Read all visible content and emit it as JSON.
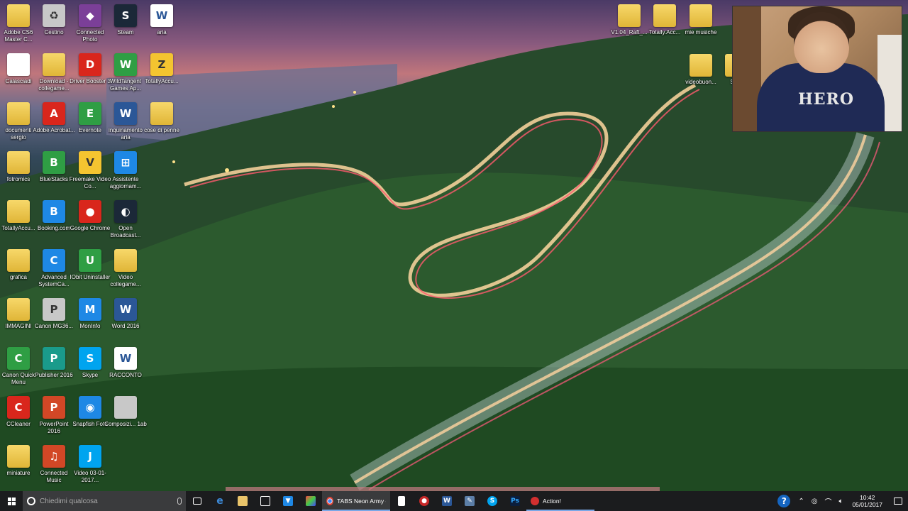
{
  "desktop": {
    "icons_col1": [
      {
        "label": "Adobe CS6 Master C...",
        "icon": "folder-icon",
        "glyph": "",
        "style": "g-folder"
      },
      {
        "label": "Calasciadi",
        "icon": "document-icon",
        "glyph": "",
        "style": "g-doc"
      },
      {
        "label": "documenti sergio",
        "icon": "folder-icon",
        "glyph": "",
        "style": "g-folder"
      },
      {
        "label": "fotromics",
        "icon": "folder-icon",
        "glyph": "",
        "style": "g-folder"
      },
      {
        "label": "TotallyAccu...",
        "icon": "folder-icon",
        "glyph": "",
        "style": "g-folder"
      },
      {
        "label": "grafica",
        "icon": "folder-icon",
        "glyph": "",
        "style": "g-folder"
      },
      {
        "label": "IMMAGINI",
        "icon": "folder-icon",
        "glyph": "",
        "style": "g-folder"
      },
      {
        "label": "Canon Quick Menu",
        "icon": "canon-icon",
        "glyph": "C",
        "style": "g-green"
      },
      {
        "label": "CCleaner",
        "icon": "ccleaner-icon",
        "glyph": "C",
        "style": "g-red"
      },
      {
        "label": "miniature",
        "icon": "folder-icon",
        "glyph": "",
        "style": "g-folder"
      }
    ],
    "icons_col2": [
      {
        "label": "Cestino",
        "icon": "recycle-bin-icon",
        "glyph": "♻",
        "style": "g-grey"
      },
      {
        "label": "Download - collegame...",
        "icon": "folder-icon",
        "glyph": "",
        "style": "g-folder"
      },
      {
        "label": "Adobe Acrobat...",
        "icon": "acrobat-icon",
        "glyph": "A",
        "style": "g-red"
      },
      {
        "label": "BlueStacks",
        "icon": "bluestacks-icon",
        "glyph": "B",
        "style": "g-green"
      },
      {
        "label": "Booking.com",
        "icon": "booking-icon",
        "glyph": "B",
        "style": "g-blue"
      },
      {
        "label": "Advanced SystemCa...",
        "icon": "advanced-systemcare-icon",
        "glyph": "C",
        "style": "g-blue"
      },
      {
        "label": "Canon MG36...",
        "icon": "printer-icon",
        "glyph": "P",
        "style": "g-grey"
      },
      {
        "label": "Publisher 2016",
        "icon": "publisher-icon",
        "glyph": "P",
        "style": "g-teal"
      },
      {
        "label": "PowerPoint 2016",
        "icon": "powerpoint-icon",
        "glyph": "P",
        "style": "g-orange"
      },
      {
        "label": "Connected Music",
        "icon": "connected-music-icon",
        "glyph": "♫",
        "style": "g-orange"
      }
    ],
    "icons_col3": [
      {
        "label": "Connected Photo",
        "icon": "connected-photo-icon",
        "glyph": "◆",
        "style": "g-purple"
      },
      {
        "label": "Driver Booster 3",
        "icon": "driver-booster-icon",
        "glyph": "D",
        "style": "g-red"
      },
      {
        "label": "Evernote",
        "icon": "evernote-icon",
        "glyph": "E",
        "style": "g-green"
      },
      {
        "label": "Freemake Video Co...",
        "icon": "freemake-icon",
        "glyph": "V",
        "style": "g-yellow"
      },
      {
        "label": "Google Chrome",
        "icon": "chrome-icon",
        "glyph": "●",
        "style": "g-red"
      },
      {
        "label": "IObit Uninstaller",
        "icon": "iobit-icon",
        "glyph": "U",
        "style": "g-green"
      },
      {
        "label": "MonInfo",
        "icon": "moninfo-icon",
        "glyph": "M",
        "style": "g-blue"
      },
      {
        "label": "Skype",
        "icon": "skype-icon",
        "glyph": "S",
        "style": "g-sky"
      },
      {
        "label": "Snapfish Foto",
        "icon": "snapfish-icon",
        "glyph": "◉",
        "style": "g-blue"
      },
      {
        "label": "Video 03-01-2017...",
        "icon": "video-icon",
        "glyph": "J",
        "style": "g-sky"
      }
    ],
    "icons_col4": [
      {
        "label": "Steam",
        "icon": "steam-icon",
        "glyph": "S",
        "style": "g-dark"
      },
      {
        "label": "WildTangent Games Ap...",
        "icon": "wildtangent-icon",
        "glyph": "W",
        "style": "g-green"
      },
      {
        "label": "inquinamento aria",
        "icon": "word-doc-icon",
        "glyph": "W",
        "style": "g-word"
      },
      {
        "label": "Assistente aggiornam...",
        "icon": "windows-update-icon",
        "glyph": "⊞",
        "style": "g-blue"
      },
      {
        "label": "Open Broadcast...",
        "icon": "obs-icon",
        "glyph": "◐",
        "style": "g-dark"
      },
      {
        "label": "Video collegame...",
        "icon": "folder-icon",
        "glyph": "",
        "style": "g-folder"
      },
      {
        "label": "Word 2016",
        "icon": "word-icon",
        "glyph": "W",
        "style": "g-word"
      },
      {
        "label": "RACCONTO",
        "icon": "word-doc-icon",
        "glyph": "W",
        "style": "g-doc"
      },
      {
        "label": "Composizi... 1ab",
        "icon": "image-icon",
        "glyph": "",
        "style": "g-grey"
      }
    ],
    "icons_col5": [
      {
        "label": "aria",
        "icon": "word-doc-icon",
        "glyph": "W",
        "style": "g-doc"
      },
      {
        "label": "TotallyAccu...",
        "icon": "zip-icon",
        "glyph": "Z",
        "style": "g-yellow"
      },
      {
        "label": "cose di penne",
        "icon": "folder-icon",
        "glyph": "",
        "style": "g-folder"
      }
    ],
    "icons_right": [
      {
        "label": "V1.04_Raft_...",
        "icon": "folder-icon",
        "glyph": "",
        "style": "g-folder"
      },
      {
        "label": "Totally.Acc...",
        "icon": "folder-icon",
        "glyph": "",
        "style": "g-folder"
      },
      {
        "label": "mie musiche",
        "icon": "folder-icon",
        "glyph": "",
        "style": "g-folder"
      },
      {
        "label": "videobuon...",
        "icon": "folder-icon",
        "glyph": "",
        "style": "g-folder"
      },
      {
        "label": "Serg",
        "icon": "folder-icon",
        "glyph": "",
        "style": "g-folder"
      }
    ]
  },
  "webcam": {
    "hoodie_text": "HERO"
  },
  "taskbar": {
    "search_placeholder": "Chiedimi qualcosa",
    "chrome_window_label": "TABS Neon Army -v...",
    "action_window_label": "Action!",
    "clock_time": "10:42",
    "clock_date": "05/01/2017",
    "help_label": "?"
  }
}
